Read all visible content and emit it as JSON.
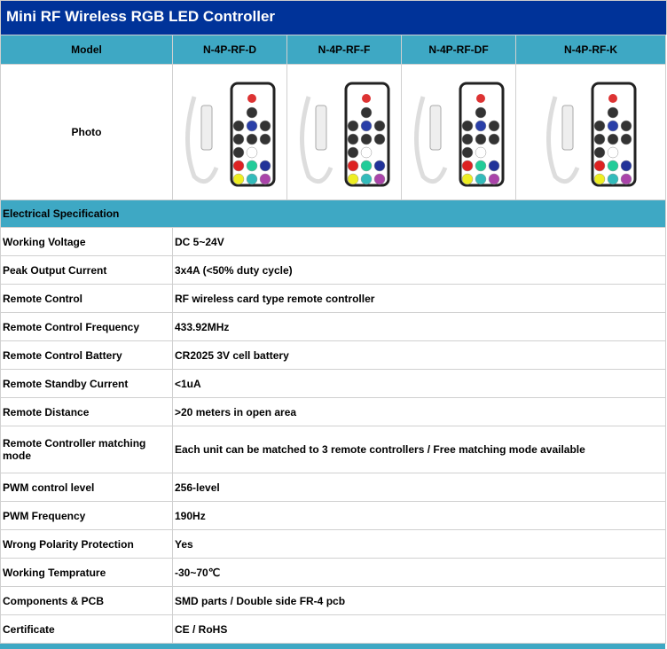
{
  "title": "Mini RF Wireless RGB LED Controller",
  "header": {
    "label": "Model",
    "models": [
      "N-4P-RF-D",
      "N-4P-RF-F",
      "N-4P-RF-DF",
      "N-4P-RF-K"
    ]
  },
  "photo_label": "Photo",
  "section": "Electrical Specification",
  "specs": [
    {
      "k": "Working Voltage",
      "v": "DC 5~24V"
    },
    {
      "k": "Peak Output Current",
      "v": "3x4A (<50% duty cycle)"
    },
    {
      "k": "Remote Control",
      "v": "RF wireless card type remote controller"
    },
    {
      "k": "Remote Control Frequency",
      "v": "433.92MHz"
    },
    {
      "k": "Remote Control Battery",
      "v": "CR2025 3V cell battery"
    },
    {
      "k": "Remote Standby Current",
      "v": "<1uA"
    },
    {
      "k": "Remote Distance",
      "v": ">20 meters in open area"
    },
    {
      "k": "Remote Controller matching mode",
      "v": "Each unit can be matched to 3 remote controllers / Free matching mode available"
    },
    {
      "k": "PWM control level",
      "v": "256-level"
    },
    {
      "k": "PWM Frequency",
      "v": "190Hz"
    },
    {
      "k": "Wrong Polarity Protection",
      "v": "Yes"
    },
    {
      "k": "Working Temprature",
      "v": "-30~70℃"
    },
    {
      "k": "Components & PCB",
      "v": "SMD parts / Double side FR-4 pcb"
    },
    {
      "k": "Certificate",
      "v": "CE / RoHS"
    }
  ]
}
